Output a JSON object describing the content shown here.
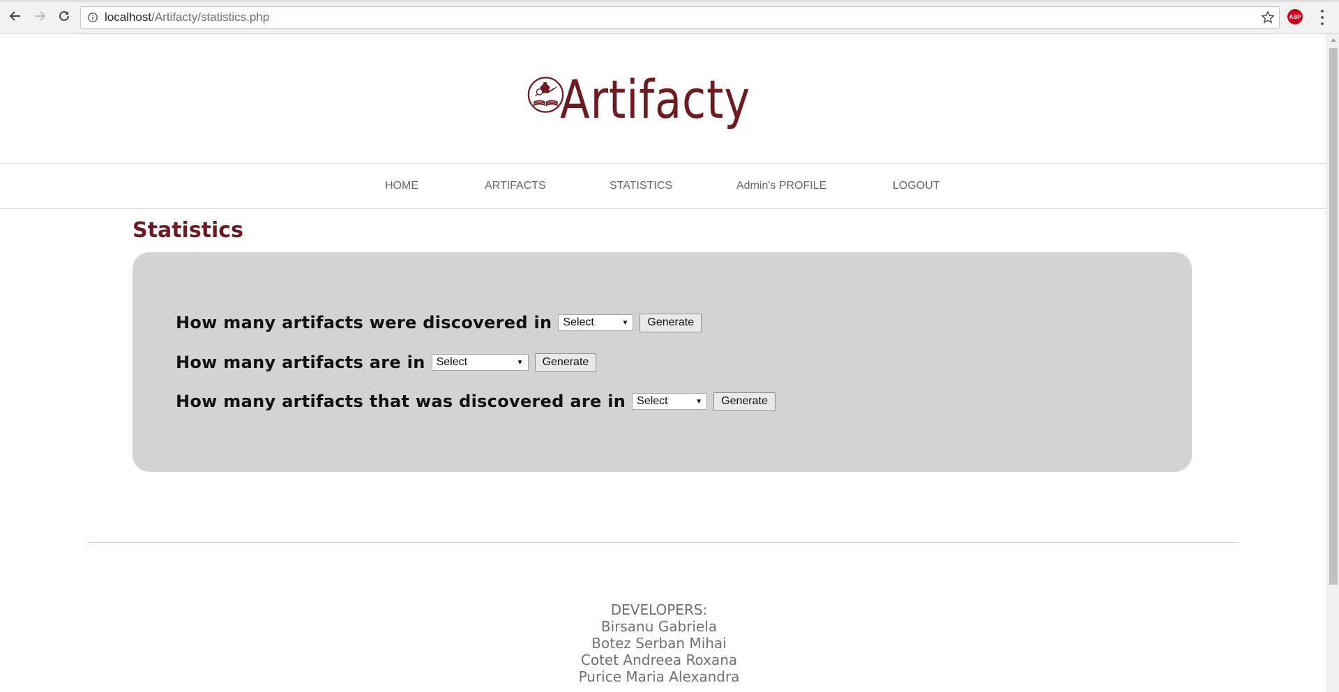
{
  "browser": {
    "url_host": "localhost",
    "url_path": "/Artifacty/statistics.php",
    "extension_badge": "ABP"
  },
  "header": {
    "brand": "Artifacty"
  },
  "nav": {
    "items": [
      {
        "label": "HOME"
      },
      {
        "label": "ARTIFACTS"
      },
      {
        "label": "STATISTICS"
      },
      {
        "label": "Admin's PROFILE"
      },
      {
        "label": "LOGOUT"
      }
    ]
  },
  "main": {
    "title": "Statistics",
    "questions": [
      {
        "label": "How many artifacts were discovered in",
        "select_value": "Select",
        "button": "Generate"
      },
      {
        "label": "How many artifacts are in",
        "select_value": "Select",
        "button": "Generate"
      },
      {
        "label": "How many artifacts that was discovered are in",
        "select_value": "Select",
        "button": "Generate"
      }
    ]
  },
  "footer": {
    "heading": "DEVELOPERS:",
    "developers": [
      "Birsanu Gabriela",
      "Botez Serban Mihai",
      "Cotet Andreea Roxana",
      "Purice Maria Alexandra"
    ]
  },
  "colors": {
    "brand": "#6d1a22",
    "panel": "#d3d3d3",
    "nav_text": "#666666",
    "footer_text": "#707070"
  }
}
